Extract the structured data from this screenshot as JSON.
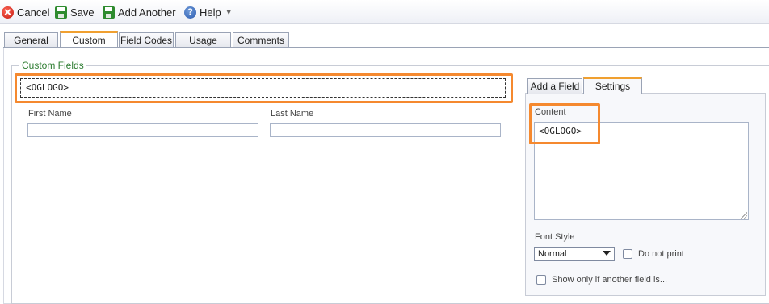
{
  "toolbar": {
    "cancel": "Cancel",
    "save": "Save",
    "add_another": "Add Another",
    "help": "Help"
  },
  "tabs": [
    {
      "label": "General",
      "active": false
    },
    {
      "label": "Custom",
      "active": true
    },
    {
      "label": "Field Codes",
      "active": false
    },
    {
      "label": "Usage",
      "active": false
    },
    {
      "label": "Comments",
      "active": false
    }
  ],
  "custom_fields": {
    "legend": "Custom Fields",
    "logo_field": "<OGLOGO>",
    "first_name_label": "First Name",
    "last_name_label": "Last Name",
    "first_name_value": "",
    "last_name_value": ""
  },
  "side_panel": {
    "tabs": [
      {
        "label": "Add a Field",
        "active": false
      },
      {
        "label": "Settings",
        "active": true
      }
    ],
    "content_label": "Content",
    "content_value": "<OGLOGO>",
    "font_style_label": "Font Style",
    "font_style_value": "Normal",
    "do_not_print_label": "Do not print",
    "do_not_print_checked": false,
    "show_only_label": "Show only if another field is...",
    "show_only_checked": false
  },
  "colors": {
    "highlight": "#f5892f",
    "tab_accent": "#f0a030",
    "legend": "#2e7d32"
  }
}
